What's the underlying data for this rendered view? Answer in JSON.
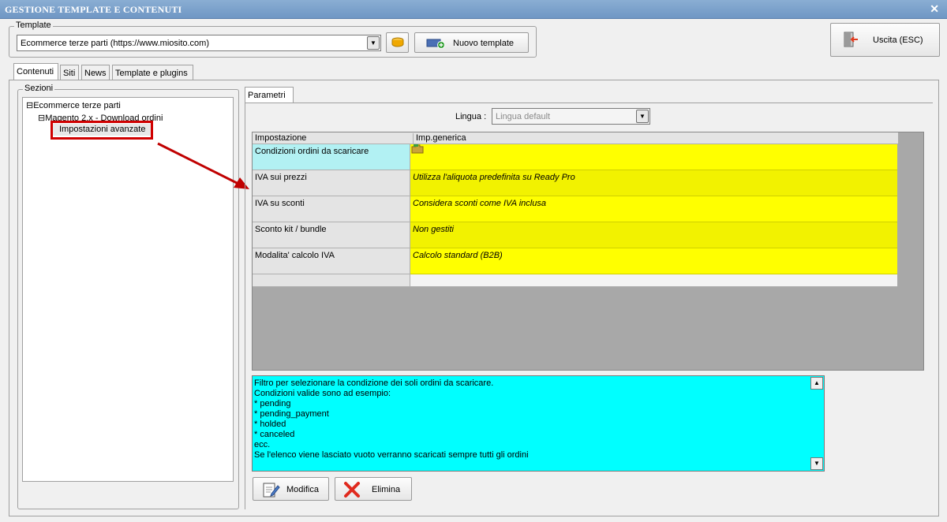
{
  "window": {
    "title": "GESTIONE TEMPLATE E CONTENUTI",
    "close_glyph": "✕"
  },
  "template_group": {
    "legend": "Template",
    "combo_value": "Ecommerce terze parti (https://www.miosito.com)",
    "new_template_label": "Nuovo template"
  },
  "exit_button": {
    "label": "Uscita (ESC)"
  },
  "tabs": [
    {
      "label": "Contenuti",
      "active": true
    },
    {
      "label": "Siti",
      "active": false
    },
    {
      "label": "News",
      "active": false
    },
    {
      "label": "Template e plugins",
      "active": false
    }
  ],
  "sections": {
    "legend": "Sezioni",
    "tree": [
      {
        "label": "Ecommerce terze parti",
        "expander": "⊟",
        "level": 0
      },
      {
        "label": "Magento 2.x - Download ordini",
        "expander": "⊟",
        "level": 1
      },
      {
        "label": "Impostazioni avanzate",
        "expander": "",
        "level": 2,
        "selected": true
      }
    ]
  },
  "params": {
    "tab_label": "Parametri",
    "lingua_label": "Lingua :",
    "lingua_value": "Lingua default",
    "grid_headers": [
      "Impostazione",
      "Imp.generica"
    ],
    "rows": [
      {
        "key": "Condizioni ordini da scaricare",
        "value": ""
      },
      {
        "key": "IVA sui prezzi",
        "value": "Utilizza l'aliquota predefinita su Ready Pro"
      },
      {
        "key": "IVA su sconti",
        "value": "Considera sconti come IVA inclusa"
      },
      {
        "key": "Sconto kit / bundle",
        "value": "Non gestiti"
      },
      {
        "key": "Modalita' calcolo IVA",
        "value": "Calcolo standard (B2B)"
      }
    ],
    "description_lines": [
      "Filtro per selezionare la condizione dei soli ordini da scaricare.",
      "Condizioni valide sono ad esempio:",
      "* pending",
      "* pending_payment",
      "* holded",
      "* canceled",
      "ecc.",
      "Se l'elenco viene lasciato vuoto verranno scaricati sempre tutti gli ordini"
    ],
    "edit_label": "Modifica",
    "delete_label": "Elimina"
  },
  "colors": {
    "titlebar": "#7aa1cc",
    "value_yellow": "#ffff00",
    "desc_cyan": "#00ffff",
    "highlight_red": "#d00000"
  }
}
